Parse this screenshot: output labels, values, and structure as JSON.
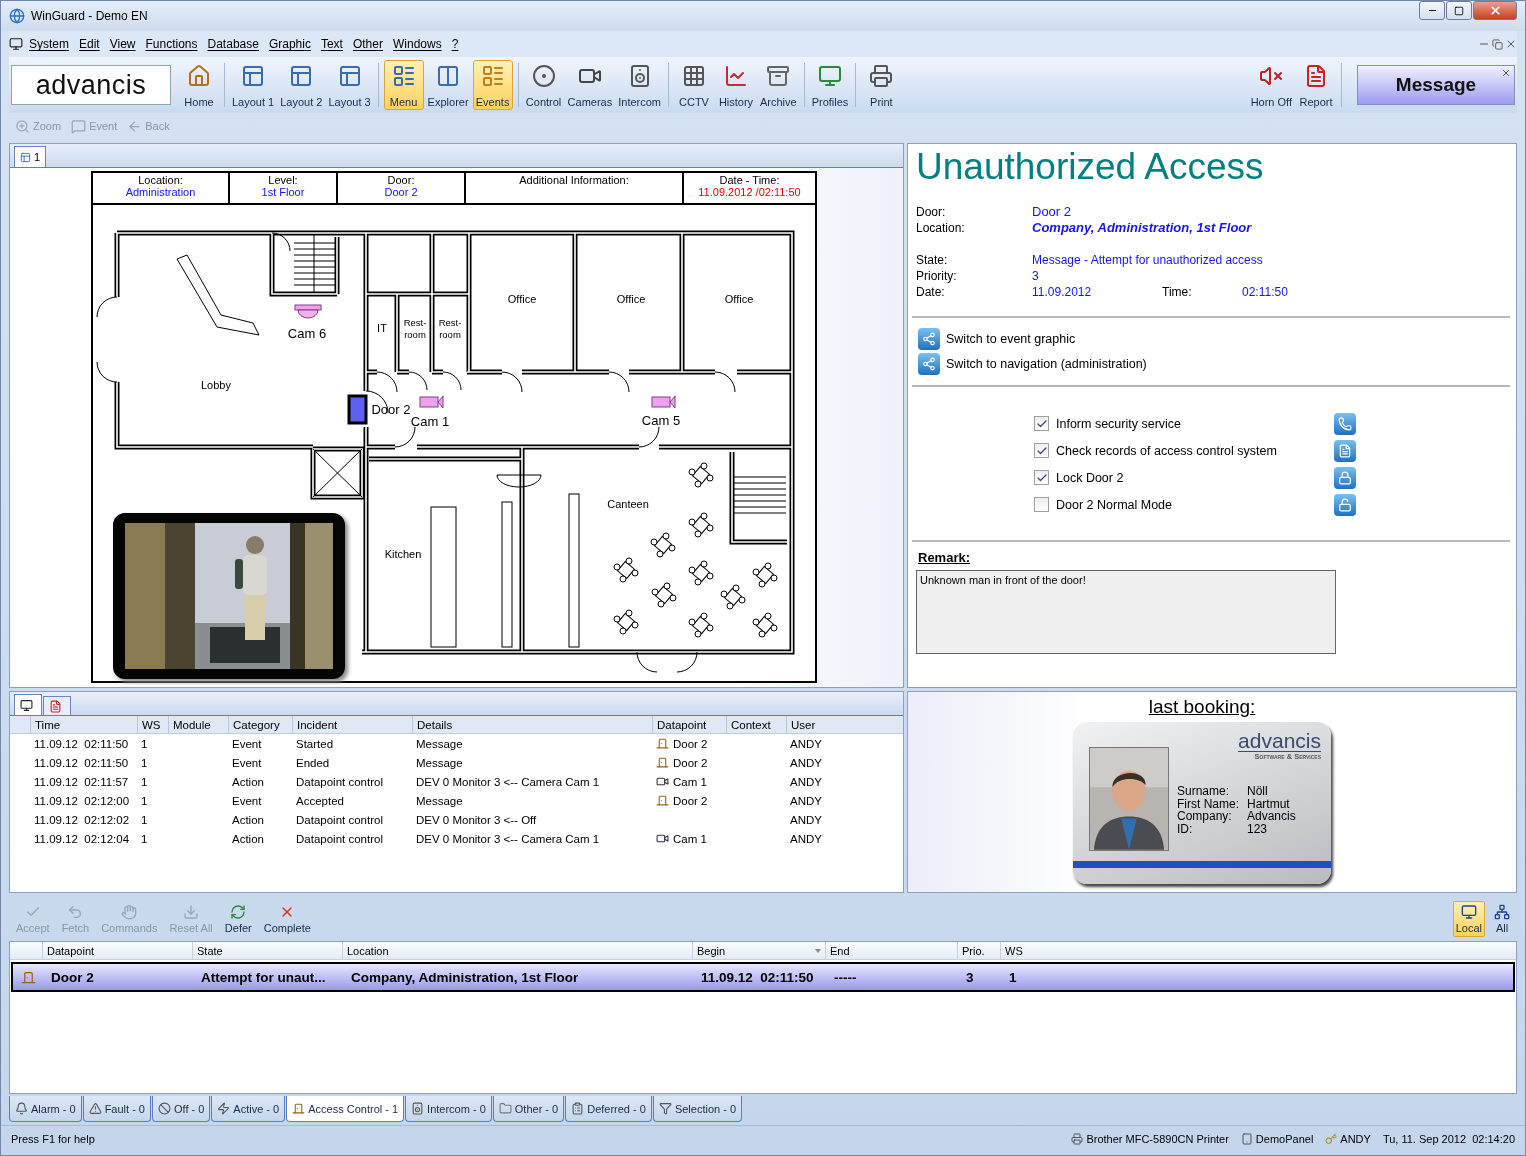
{
  "window": {
    "title": "WinGuard - Demo EN"
  },
  "menu": [
    "System",
    "Edit",
    "View",
    "Functions",
    "Database",
    "Graphic",
    "Text",
    "Other",
    "Windows",
    "?"
  ],
  "toolbar": {
    "logo": "advancis",
    "groups": [
      [
        {
          "label": "Home",
          "kind": "home",
          "selected": false
        }
      ],
      [
        {
          "label": "Layout 1",
          "kind": "layout",
          "selected": false
        },
        {
          "label": "Layout 2",
          "kind": "layout",
          "selected": false
        },
        {
          "label": "Layout 3",
          "kind": "layout",
          "selected": false
        }
      ],
      [
        {
          "label": "Menu",
          "kind": "menu",
          "selected": true
        },
        {
          "label": "Explorer",
          "kind": "explorer",
          "selected": false
        },
        {
          "label": "Events",
          "kind": "events",
          "selected": true
        }
      ],
      [
        {
          "label": "Control",
          "kind": "control",
          "selected": false
        },
        {
          "label": "Cameras",
          "kind": "cameras",
          "selected": false
        },
        {
          "label": "Intercom",
          "kind": "intercom",
          "selected": false
        }
      ],
      [
        {
          "label": "CCTV",
          "kind": "cctv",
          "selected": false
        },
        {
          "label": "History",
          "kind": "history",
          "selected": false
        },
        {
          "label": "Archive",
          "kind": "archive",
          "selected": false
        }
      ],
      [
        {
          "label": "Profiles",
          "kind": "profiles",
          "selected": false
        }
      ],
      [
        {
          "label": "Print",
          "kind": "print",
          "selected": false
        }
      ]
    ],
    "right": [
      {
        "label": "Horn Off",
        "kind": "horn"
      },
      {
        "label": "Report",
        "kind": "pdf"
      }
    ],
    "message": "Message"
  },
  "subtoolbar": [
    {
      "label": "Zoom",
      "kind": "zoom",
      "disabled": true
    },
    {
      "label": "Event",
      "kind": "event",
      "disabled": true
    },
    {
      "label": "Back",
      "kind": "back",
      "disabled": true
    }
  ],
  "graphic": {
    "tab": "1",
    "header": [
      {
        "label": "Location:",
        "value": "Administration",
        "kind": "link"
      },
      {
        "label": "Level:",
        "value": "1st Floor",
        "kind": "link"
      },
      {
        "label": "Door:",
        "value": "Door 2",
        "kind": "link"
      },
      {
        "label": "Additional Information:"
      },
      {
        "label": "Date - Time:",
        "value": "11.09.2012 /02:11:50",
        "kind": "alert"
      }
    ],
    "rooms": [
      {
        "lines": [
          "Lobby"
        ]
      },
      {
        "lines": [
          "IT"
        ]
      },
      {
        "lines": [
          "Rest-",
          "room"
        ]
      },
      {
        "lines": [
          "Rest-",
          "room"
        ]
      },
      {
        "lines": [
          "Office"
        ]
      },
      {
        "lines": [
          "Office"
        ]
      },
      {
        "lines": [
          "Office"
        ]
      },
      {
        "lines": [
          "Canteen"
        ]
      },
      {
        "lines": [
          "Kitchen"
        ]
      }
    ],
    "devices": [
      {
        "kind": "dome",
        "label": "Cam 6"
      },
      {
        "kind": "door",
        "label": "Door 2"
      },
      {
        "kind": "camera",
        "label": "Cam 1"
      },
      {
        "kind": "camera",
        "label": "Cam 5"
      }
    ]
  },
  "event": {
    "title": "Unauthorized Access",
    "identity": [
      {
        "label": "Door:",
        "value": "Door 2",
        "kind": "strong"
      },
      {
        "label": "Location:",
        "value": "Company, Administration, 1st Floor",
        "kind": "emphasis"
      }
    ],
    "details": [
      {
        "label": "State:",
        "value": "Message - Attempt for unauthorized access"
      },
      {
        "label": "Priority:",
        "value": "3"
      },
      {
        "label": "Date:",
        "value": "11.09.2012",
        "extra_label": "Time:",
        "extra_value": "02:11:50"
      }
    ],
    "links": [
      "Switch to event graphic",
      "Switch to navigation (administration)"
    ],
    "tasks": [
      {
        "label": "Inform security service",
        "checked": true,
        "kind": "phone"
      },
      {
        "label": "Check records of access control system",
        "checked": true,
        "kind": "records"
      },
      {
        "label": "Lock Door 2",
        "checked": true,
        "kind": "lock"
      },
      {
        "label": "Door 2 Normal Mode",
        "checked": false,
        "kind": "unlock"
      }
    ],
    "remark": {
      "label": "Remark:",
      "value": "Unknown man in front of the door!"
    }
  },
  "log": {
    "tabs": [
      {
        "kind": "monitor",
        "selected": true
      },
      {
        "kind": "pdf",
        "selected": false
      }
    ],
    "columns": [
      "Time",
      "WS",
      "Module",
      "Category",
      "Incident",
      "Details",
      "Datapoint",
      "Context",
      "User"
    ],
    "rows": [
      {
        "time": "11.09.12  02:11:50",
        "ws": "1",
        "category": "Event",
        "incident": "Started",
        "details": "Message",
        "datapoint": {
          "kind": "door",
          "label": "Door 2"
        },
        "user": "ANDY"
      },
      {
        "time": "11.09.12  02:11:50",
        "ws": "1",
        "category": "Event",
        "incident": "Ended",
        "details": "Message",
        "datapoint": {
          "kind": "door",
          "label": "Door 2"
        },
        "user": "ANDY"
      },
      {
        "time": "11.09.12  02:11:57",
        "ws": "1",
        "category": "Action",
        "incident": "Datapoint control",
        "details": "DEV 0 Monitor 3 <-- Camera Cam 1",
        "datapoint": {
          "kind": "camera",
          "label": "Cam 1"
        },
        "user": "ANDY"
      },
      {
        "time": "11.09.12  02:12:00",
        "ws": "1",
        "category": "Event",
        "incident": "Accepted",
        "details": "Message",
        "datapoint": {
          "kind": "door",
          "label": "Door 2"
        },
        "user": "ANDY"
      },
      {
        "time": "11.09.12  02:12:02",
        "ws": "1",
        "category": "Action",
        "incident": "Datapoint control",
        "details": "DEV 0 Monitor 3 <-- Off",
        "user": "ANDY"
      },
      {
        "time": "11.09.12  02:12:04",
        "ws": "1",
        "category": "Action",
        "incident": "Datapoint control",
        "details": "DEV 0 Monitor 3 <-- Camera Cam 1",
        "datapoint": {
          "kind": "camera",
          "label": "Cam 1"
        },
        "user": "ANDY"
      }
    ]
  },
  "booking": {
    "title": "last booking:",
    "card": {
      "logo": "advancis",
      "tagline": "Software & Services",
      "fields": [
        {
          "label": "Surname:",
          "value": "Nöll"
        },
        {
          "label": "First Name:",
          "value": "Hartmut"
        },
        {
          "label": "Company:",
          "value": "Advancis"
        },
        {
          "label": "ID:",
          "value": "123"
        }
      ]
    }
  },
  "actions": [
    {
      "label": "Accept",
      "kind": "check",
      "disabled": true
    },
    {
      "label": "Fetch",
      "kind": "fetch",
      "disabled": true
    },
    {
      "label": "Commands",
      "kind": "commands",
      "disabled": true
    },
    {
      "label": "Reset All",
      "kind": "reset",
      "disabled": true
    },
    {
      "label": "Defer",
      "kind": "defer",
      "disabled": false
    },
    {
      "label": "Complete",
      "kind": "complete",
      "disabled": false
    }
  ],
  "scope": [
    {
      "label": "Local",
      "kind": "local",
      "selected": true
    },
    {
      "label": "All",
      "kind": "all",
      "selected": false
    }
  ],
  "events": {
    "columns": [
      {
        "label": "Datapoint",
        "sorted": false
      },
      {
        "label": "State",
        "sorted": false
      },
      {
        "label": "Location",
        "sorted": false
      },
      {
        "label": "Begin",
        "sorted": true
      },
      {
        "label": "End",
        "sorted": false
      },
      {
        "label": "Prio.",
        "sorted": false
      },
      {
        "label": "WS",
        "sorted": false
      }
    ],
    "rows": [
      {
        "selected": true,
        "kind": "door",
        "cells": [
          "Door 2",
          "Attempt for unaut...",
          "Company, Administration, 1st Floor",
          "11.09.12  02:11:50",
          "-----",
          "3",
          "1"
        ]
      }
    ]
  },
  "categories": [
    {
      "label": "Alarm - 0",
      "kind": "bell",
      "selected": false
    },
    {
      "label": "Fault - 0",
      "kind": "fault",
      "selected": false
    },
    {
      "label": "Off - 0",
      "kind": "off",
      "selected": false
    },
    {
      "label": "Active - 0",
      "kind": "active",
      "selected": false
    },
    {
      "label": "Access Control - 1",
      "kind": "door",
      "selected": true
    },
    {
      "label": "Intercom - 0",
      "kind": "intercom",
      "selected": false
    },
    {
      "label": "Other - 0",
      "kind": "folder",
      "selected": false
    },
    {
      "label": "Deferred - 0",
      "kind": "deferred",
      "selected": false
    },
    {
      "label": "Selection - 0",
      "kind": "filter",
      "selected": false
    }
  ],
  "status": {
    "help": "Press F1 for help",
    "items": [
      {
        "kind": "print",
        "label": "Brother MFC-5890CN Printer"
      },
      {
        "kind": "panel",
        "label": "DemoPanel"
      },
      {
        "kind": "key",
        "label": "ANDY"
      },
      {
        "label": "Tu, 11. Sep 2012  02:14:20"
      }
    ]
  }
}
